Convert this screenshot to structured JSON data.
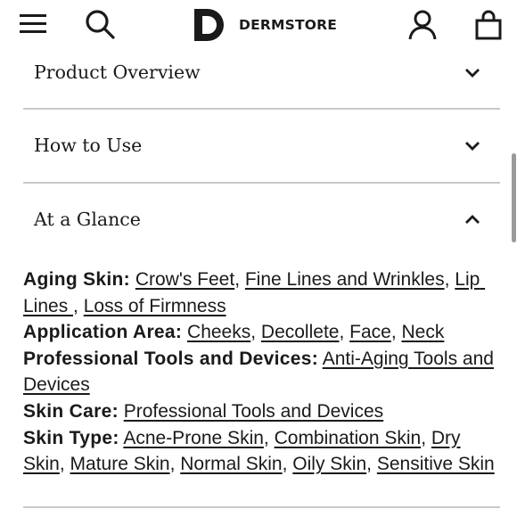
{
  "header": {
    "menu_icon": "hamburger-menu-icon",
    "search_icon": "search-icon",
    "logo_mark": "D",
    "logo_word": "DERMSTORE",
    "account_icon": "account-icon",
    "bag_icon": "shopping-bag-icon"
  },
  "accordion": [
    {
      "label": "Product Overview",
      "state": "collapsed"
    },
    {
      "label": "How to Use",
      "state": "collapsed"
    },
    {
      "label": "At a Glance",
      "state": "expanded"
    }
  ],
  "at_a_glance": {
    "aging_skin": {
      "label": "Aging Skin:",
      "links": [
        "Crow's Feet",
        "Fine Lines and Wrinkles",
        "Lip Lines ",
        "Loss of Firmness"
      ]
    },
    "application_area": {
      "label": "Application Area:",
      "links": [
        "Cheeks",
        "Decollete",
        "Face",
        "Neck"
      ]
    },
    "professional_tools": {
      "label": "Professional Tools and Devices:",
      "links": [
        "Anti-Aging Tools and Devices"
      ]
    },
    "skin_care": {
      "label": "Skin Care:",
      "links": [
        "Professional Tools and Devices"
      ]
    },
    "skin_type": {
      "label": "Skin Type:",
      "links": [
        "Acne-Prone Skin",
        "Combination Skin",
        "Dry Skin",
        "Mature Skin",
        "Normal Skin",
        "Oily Skin",
        "Sensitive Skin"
      ]
    }
  },
  "colors": {
    "text": "#1a1a1a",
    "divider": "#c9c9c9",
    "background": "#ffffff"
  }
}
